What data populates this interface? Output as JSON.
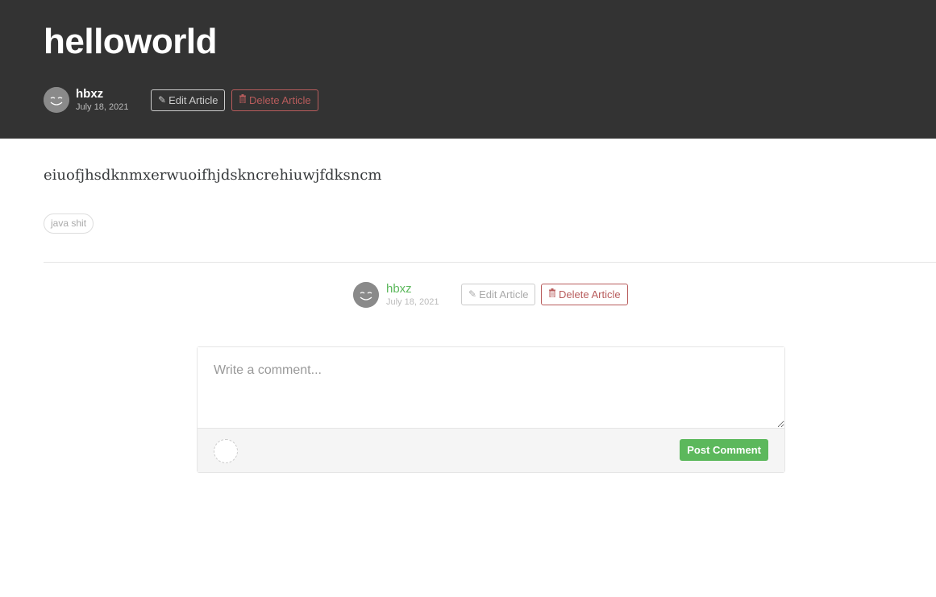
{
  "article": {
    "title": "helloworld",
    "body": "eiuofjhsdknmxerwuoifhjdskncrehiuwjfdksncm",
    "tags": [
      "java shit"
    ]
  },
  "author": {
    "name": "hbxz",
    "date": "July 18, 2021",
    "avatar_icon": "smiley-avatar-icon"
  },
  "actions": {
    "edit_label": "Edit Article",
    "delete_label": "Delete Article",
    "edit_icon": "pencil-icon",
    "delete_icon": "trash-icon"
  },
  "comment": {
    "placeholder": "Write a comment...",
    "post_label": "Post Comment"
  },
  "colors": {
    "banner_bg": "#333333",
    "accent_green": "#5cb85c",
    "danger_red": "#b85c5c"
  }
}
